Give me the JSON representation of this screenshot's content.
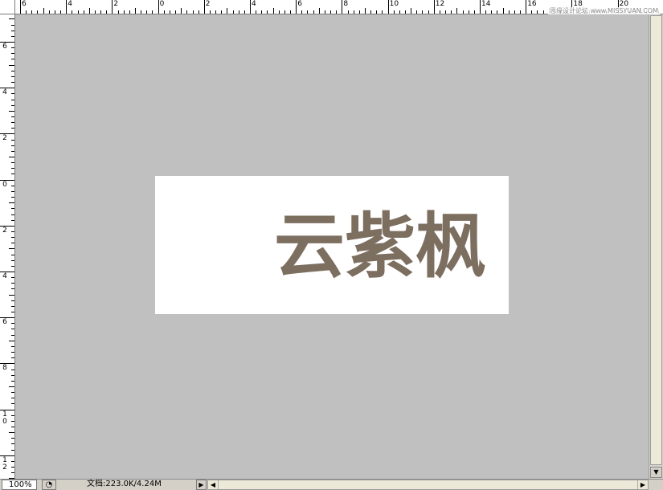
{
  "ruler_top": {
    "labels": [
      "6",
      "4",
      "2",
      "0",
      "2",
      "4",
      "6",
      "8",
      "10",
      "12",
      "14",
      "16",
      "18",
      "20"
    ]
  },
  "ruler_left": {
    "labels": [
      "6",
      "4",
      "2",
      "0",
      "2",
      "4",
      "6",
      "8",
      "10",
      "12"
    ]
  },
  "watermark": "思缘设计论坛 www.MISSYUAN.COM",
  "canvas": {
    "text": "云紫枫",
    "text_color": "#7d6f60",
    "doc_background": "#ffffff",
    "workspace_background": "#c0c0c0"
  },
  "statusbar": {
    "zoom": "100%",
    "doc_info": "文档:223.0K/4.24M",
    "status_icon": "◔",
    "arrow": "▶"
  }
}
